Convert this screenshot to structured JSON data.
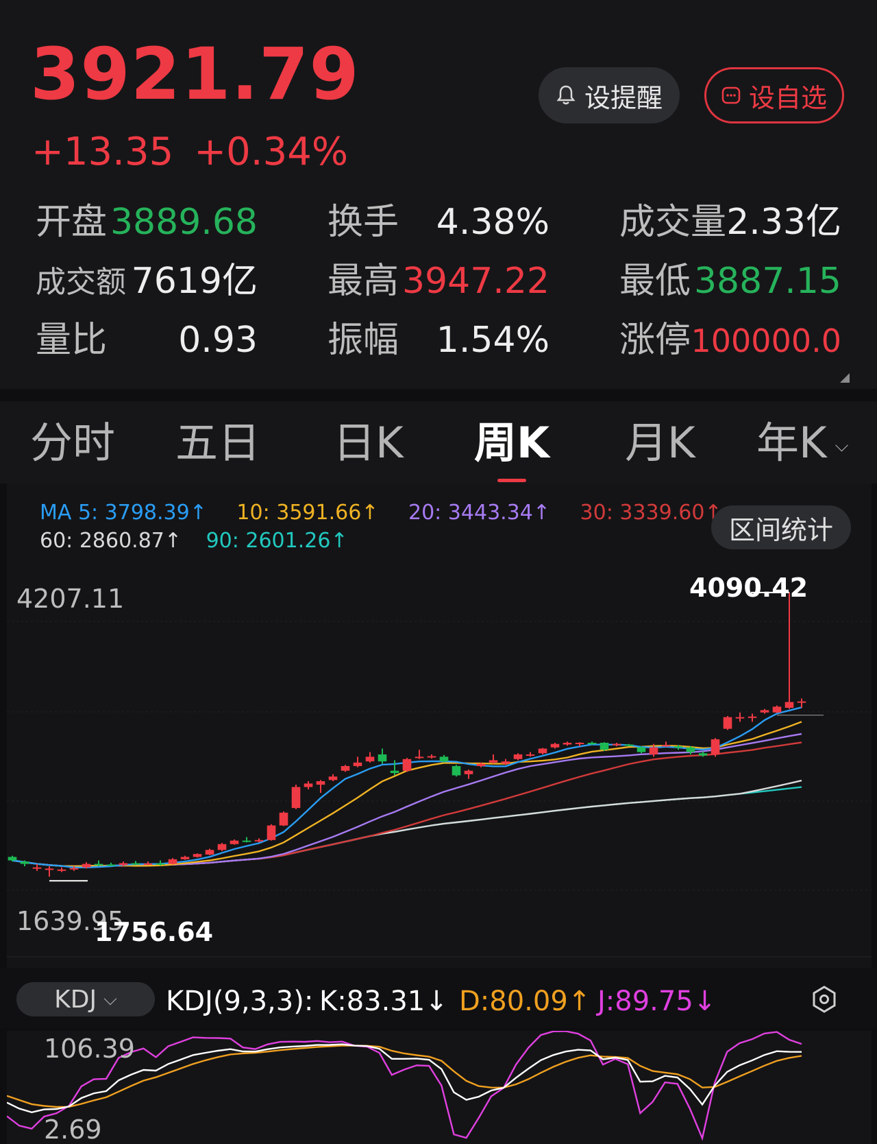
{
  "quote": {
    "price": "3921.79",
    "change": "+13.35",
    "change_pct": "+0.34%"
  },
  "buttons": {
    "alert_label": "设提醒",
    "fav_label": "设自选"
  },
  "stats": [
    {
      "label": "开盘",
      "value": "3889.68",
      "color": "#26b35b"
    },
    {
      "label": "换手",
      "value": "4.38%",
      "color": "#eeeeee"
    },
    {
      "label": "成交量",
      "value": "2.33亿",
      "color": "#eeeeee"
    },
    {
      "label": "成交额",
      "value": "7619亿",
      "color": "#eeeeee"
    },
    {
      "label": "最高",
      "value": "3947.22",
      "color": "#ee3a44"
    },
    {
      "label": "最低",
      "value": "3887.15",
      "color": "#26b35b"
    },
    {
      "label": "量比",
      "value": "0.93",
      "color": "#eeeeee"
    },
    {
      "label": "振幅",
      "value": "1.54%",
      "color": "#eeeeee"
    },
    {
      "label": "涨停",
      "value": "100000.0",
      "color": "#ee3a44"
    }
  ],
  "tabs": [
    {
      "label": "分时",
      "active": false
    },
    {
      "label": "五日",
      "active": false
    },
    {
      "label": "日K",
      "active": false
    },
    {
      "label": "周K",
      "active": true
    },
    {
      "label": "月K",
      "active": false
    },
    {
      "label": "年K",
      "active": false
    }
  ],
  "ma": {
    "ma5": "MA 5: 3798.39",
    "ma10": "10: 3591.66",
    "ma20": "20: 3443.34",
    "ma30": "30: 3339.60",
    "ma60": "60: 2860.87",
    "ma90": "90: 2601.26",
    "arrow": "↑",
    "colors": {
      "ma5": "#2a9df4",
      "ma10": "#f0b323",
      "ma20": "#a77bf3",
      "ma30": "#d23a3a",
      "ma60": "#d9d9d9",
      "ma90": "#21c9c0"
    }
  },
  "range_button": "区间统计",
  "axis": {
    "top": "4207.11",
    "bottom": "1639.95",
    "high_mark": "4090.42",
    "low_mark": "1756.64"
  },
  "kdj": {
    "selector": "KDJ",
    "params": "KDJ(9,3,3):",
    "k": "K:83.31",
    "d": "D:80.09",
    "j": "J:89.75",
    "k_arrow": "↓",
    "d_arrow": "↑",
    "j_arrow": "↓",
    "axis_top": "106.39",
    "axis_bottom": "2.69",
    "colors": {
      "k": "#ffffff",
      "d": "#f0a020",
      "j": "#e040e0"
    }
  },
  "chart_data": {
    "type": "line",
    "title": "",
    "xlabel": "",
    "ylabel": "",
    "ylim": [
      1639.95,
      4207.11
    ],
    "candles": [
      {
        "o": 1820,
        "c": 1790,
        "h": 1830,
        "l": 1780
      },
      {
        "o": 1780,
        "c": 1760,
        "h": 1790,
        "l": 1740
      },
      {
        "o": 1720,
        "c": 1730,
        "h": 1760,
        "l": 1700
      },
      {
        "o": 1710,
        "c": 1720,
        "h": 1740,
        "l": 1650
      },
      {
        "o": 1700,
        "c": 1712,
        "h": 1730,
        "l": 1690
      },
      {
        "o": 1712,
        "c": 1724,
        "h": 1740,
        "l": 1700
      },
      {
        "o": 1730,
        "c": 1760,
        "h": 1775,
        "l": 1720
      },
      {
        "o": 1760,
        "c": 1755,
        "h": 1790,
        "l": 1740
      },
      {
        "o": 1755,
        "c": 1750,
        "h": 1770,
        "l": 1740
      },
      {
        "o": 1750,
        "c": 1766,
        "h": 1780,
        "l": 1740
      },
      {
        "o": 1766,
        "c": 1760,
        "h": 1785,
        "l": 1750
      },
      {
        "o": 1760,
        "c": 1764,
        "h": 1780,
        "l": 1750
      },
      {
        "o": 1764,
        "c": 1760,
        "h": 1790,
        "l": 1745
      },
      {
        "o": 1760,
        "c": 1800,
        "h": 1810,
        "l": 1755
      },
      {
        "o": 1800,
        "c": 1820,
        "h": 1830,
        "l": 1795
      },
      {
        "o": 1820,
        "c": 1845,
        "h": 1850,
        "l": 1815
      },
      {
        "o": 1840,
        "c": 1880,
        "h": 1890,
        "l": 1835
      },
      {
        "o": 1880,
        "c": 1930,
        "h": 1940,
        "l": 1870
      },
      {
        "o": 1930,
        "c": 1960,
        "h": 1970,
        "l": 1925
      },
      {
        "o": 1960,
        "c": 1955,
        "h": 1990,
        "l": 1945
      },
      {
        "o": 1955,
        "c": 1965,
        "h": 1980,
        "l": 1945
      },
      {
        "o": 1965,
        "c": 2090,
        "h": 2100,
        "l": 1960
      },
      {
        "o": 2090,
        "c": 2200,
        "h": 2210,
        "l": 2085
      },
      {
        "o": 2240,
        "c": 2420,
        "h": 2440,
        "l": 2230
      },
      {
        "o": 2420,
        "c": 2450,
        "h": 2470,
        "l": 2400
      },
      {
        "o": 2440,
        "c": 2470,
        "h": 2480,
        "l": 2370
      },
      {
        "o": 2480,
        "c": 2510,
        "h": 2530,
        "l": 2470
      },
      {
        "o": 2560,
        "c": 2600,
        "h": 2610,
        "l": 2550
      },
      {
        "o": 2600,
        "c": 2630,
        "h": 2680,
        "l": 2590
      },
      {
        "o": 2640,
        "c": 2680,
        "h": 2720,
        "l": 2630
      },
      {
        "o": 2700,
        "c": 2640,
        "h": 2750,
        "l": 2620
      },
      {
        "o": 2560,
        "c": 2540,
        "h": 2650,
        "l": 2520
      },
      {
        "o": 2560,
        "c": 2660,
        "h": 2670,
        "l": 2550
      },
      {
        "o": 2670,
        "c": 2680,
        "h": 2740,
        "l": 2660
      },
      {
        "o": 2680,
        "c": 2685,
        "h": 2700,
        "l": 2665
      },
      {
        "o": 2680,
        "c": 2640,
        "h": 2695,
        "l": 2630
      },
      {
        "o": 2600,
        "c": 2520,
        "h": 2610,
        "l": 2510
      },
      {
        "o": 2530,
        "c": 2560,
        "h": 2570,
        "l": 2490
      },
      {
        "o": 2600,
        "c": 2620,
        "h": 2630,
        "l": 2590
      },
      {
        "o": 2630,
        "c": 2650,
        "h": 2700,
        "l": 2620
      },
      {
        "o": 2620,
        "c": 2640,
        "h": 2660,
        "l": 2610
      },
      {
        "o": 2660,
        "c": 2700,
        "h": 2710,
        "l": 2650
      },
      {
        "o": 2690,
        "c": 2700,
        "h": 2720,
        "l": 2680
      },
      {
        "o": 2710,
        "c": 2750,
        "h": 2755,
        "l": 2700
      },
      {
        "o": 2760,
        "c": 2790,
        "h": 2800,
        "l": 2750
      },
      {
        "o": 2785,
        "c": 2800,
        "h": 2810,
        "l": 2775
      },
      {
        "o": 2795,
        "c": 2800,
        "h": 2805,
        "l": 2770
      },
      {
        "o": 2800,
        "c": 2790,
        "h": 2810,
        "l": 2780
      },
      {
        "o": 2800,
        "c": 2740,
        "h": 2805,
        "l": 2730
      },
      {
        "o": 2780,
        "c": 2790,
        "h": 2800,
        "l": 2770
      },
      {
        "o": 2785,
        "c": 2780,
        "h": 2790,
        "l": 2770
      },
      {
        "o": 2760,
        "c": 2720,
        "h": 2770,
        "l": 2710
      },
      {
        "o": 2700,
        "c": 2760,
        "h": 2790,
        "l": 2680
      },
      {
        "o": 2770,
        "c": 2780,
        "h": 2810,
        "l": 2765
      },
      {
        "o": 2770,
        "c": 2760,
        "h": 2780,
        "l": 2740
      },
      {
        "o": 2760,
        "c": 2720,
        "h": 2770,
        "l": 2700
      },
      {
        "o": 2710,
        "c": 2690,
        "h": 2725,
        "l": 2680
      },
      {
        "o": 2700,
        "c": 2830,
        "h": 2840,
        "l": 2680
      },
      {
        "o": 2920,
        "c": 3020,
        "h": 3030,
        "l": 2910
      },
      {
        "o": 3010,
        "c": 3020,
        "h": 3060,
        "l": 2980
      },
      {
        "o": 3020,
        "c": 3025,
        "h": 3050,
        "l": 2980
      },
      {
        "o": 3060,
        "c": 3080,
        "h": 3090,
        "l": 3050
      },
      {
        "o": 3060,
        "c": 3110,
        "h": 3120,
        "l": 3055
      },
      {
        "o": 3100,
        "c": 3150,
        "h": 4090.42,
        "l": 3090
      },
      {
        "o": 3150,
        "c": 3155,
        "h": 3180,
        "l": 3100
      }
    ]
  }
}
